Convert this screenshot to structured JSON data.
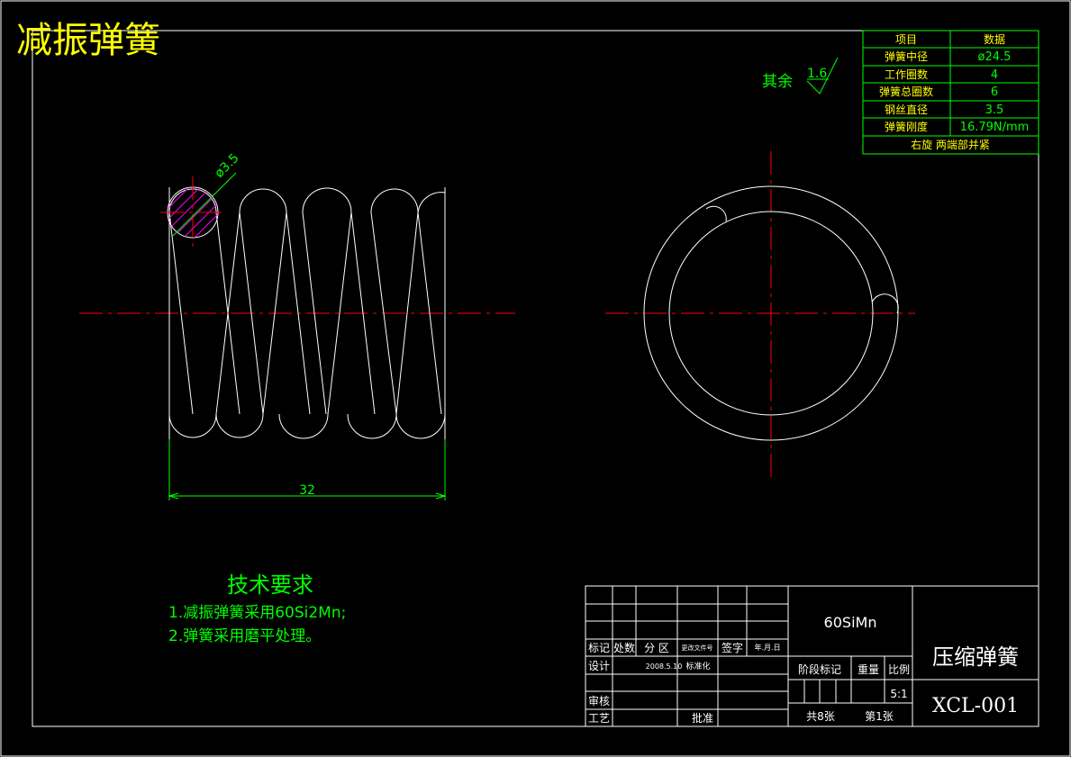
{
  "title": "减振弹簧",
  "roughness": {
    "label": "其余",
    "value": "1.6"
  },
  "spec_table": {
    "headers": [
      "项目",
      "数据"
    ],
    "rows": [
      [
        "弹簧中径",
        "ø24.5"
      ],
      [
        "工作圈数",
        "4"
      ],
      [
        "弹簧总圈数",
        "6"
      ],
      [
        "钢丝直径",
        "3.5"
      ],
      [
        "弹簧刚度",
        "16.79N/mm"
      ]
    ],
    "footer": "右旋   两端部并紧"
  },
  "dimensions": {
    "wire_diameter": "ø3.5",
    "length": "32"
  },
  "tech_requirements": {
    "heading": "技术要求",
    "items": [
      "1.减振弹簧采用60Si2Mn;",
      "2.弹簧采用磨平处理。"
    ]
  },
  "title_block": {
    "material": "60SiMn",
    "part_name": "压缩弹簧",
    "drawing_no": "XCL-001",
    "revision_headers": [
      "标记",
      "处数",
      "分 区",
      "更改文件号",
      "签字",
      "年.月.日"
    ],
    "design_label": "设计",
    "design_date": "2008.5.10",
    "standardize_label": "标准化",
    "review_label": "审核",
    "process_label": "工艺",
    "approve_label": "批准",
    "stage_label": "阶段标记",
    "weight_label": "重量",
    "scale_label": "比例",
    "scale_value": "5:1",
    "sheets_total": "共8张",
    "sheet_no": "第1张"
  },
  "colors": {
    "line": "#ffffff",
    "dimension": "#00ff00",
    "centerline": "#ff0000",
    "title": "#ffff00",
    "hatch": "#ff00ff"
  }
}
